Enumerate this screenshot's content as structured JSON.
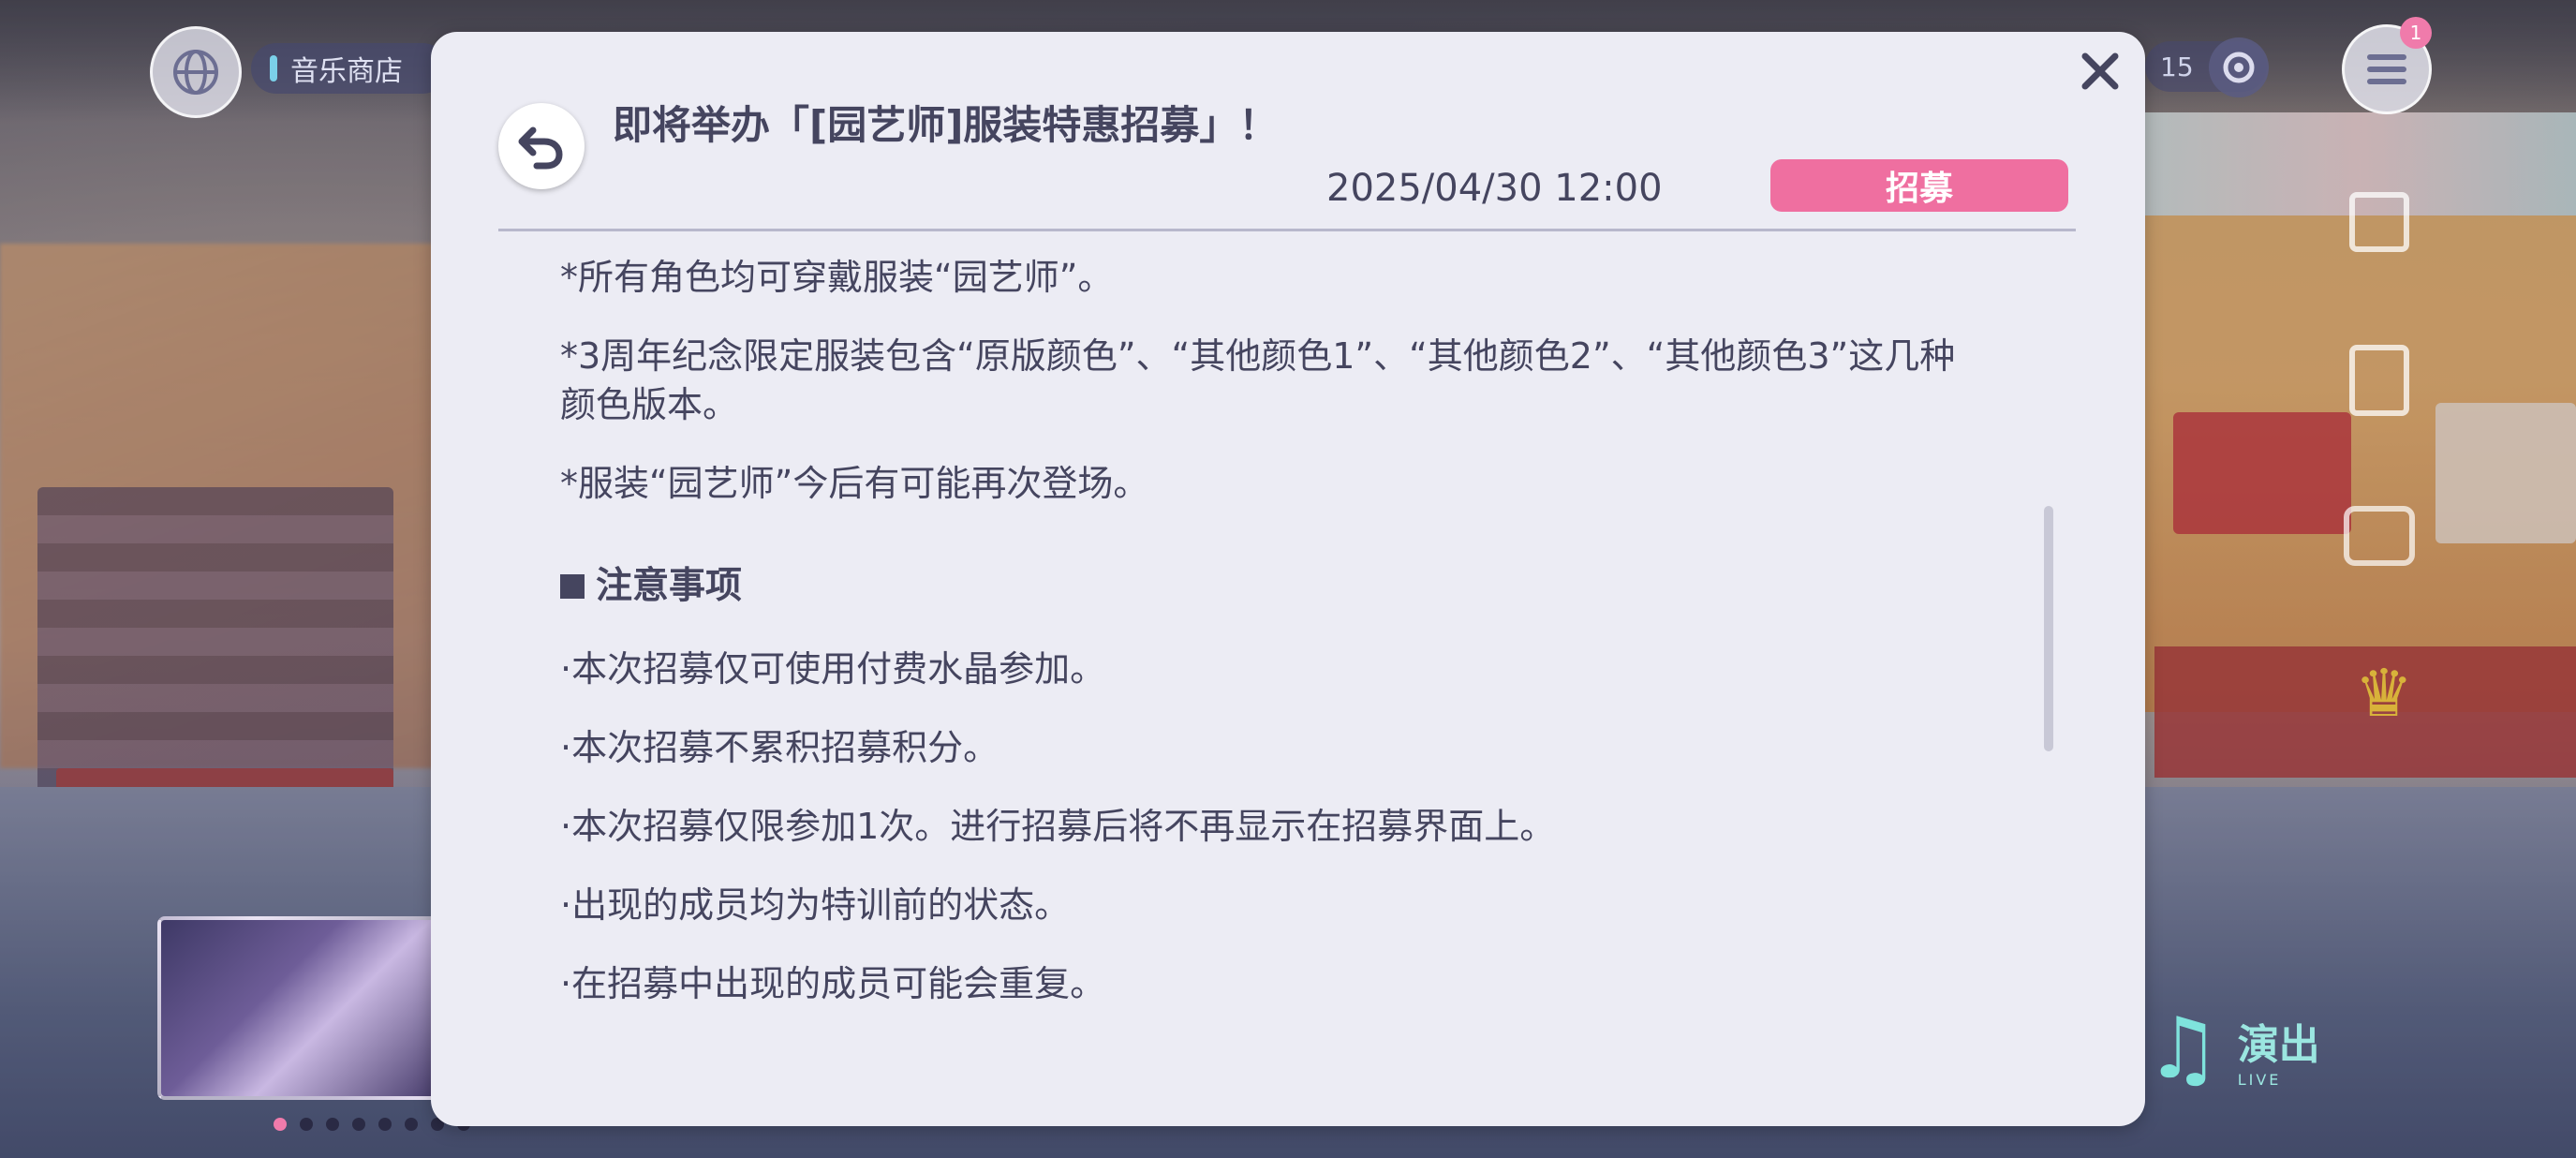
{
  "background": {
    "shop_label": "音乐商店",
    "right_counter": "15",
    "menu_badge": "1",
    "live_label": "演出",
    "live_sublabel": "LIVE"
  },
  "dialog": {
    "title": "即将举办「[园艺师]服装特惠招募」！",
    "date": "2025/04/30 12:00",
    "category": "招募",
    "paragraphs": [
      "*所有角色均可穿戴服装“园艺师”。",
      "*3周年纪念限定服装包含“原版颜色”、“其他颜色1”、“其他颜色2”、“其他颜色3”这几种",
      "颜色版本。",
      "*服装“园艺师”今后有可能再次登场。"
    ],
    "notes_heading": "注意事项",
    "notes": [
      "·本次招募仅可使用付费水晶参加。",
      "·本次招募不累积招募积分。",
      "·本次招募仅限参加1次。进行招募后将不再显示在招募界面上。",
      "·出现的成员均为特训前的状态。",
      "·在招募中出现的成员可能会重复。"
    ]
  },
  "colors": {
    "dialog_bg": "#ececf4",
    "text": "#45455f",
    "badge": "#ef6fa0",
    "divider": "#b8b8cc"
  },
  "icons": {
    "close": "close-icon",
    "back": "back-arrow-icon",
    "globe": "globe-icon",
    "settings": "gear-icon",
    "menu": "hamburger-menu-icon",
    "gift": "gift-icon",
    "clipboard": "clipboard-icon",
    "camera": "camera-icon",
    "trophy": "trophy-icon",
    "live": "music-note-icon"
  }
}
